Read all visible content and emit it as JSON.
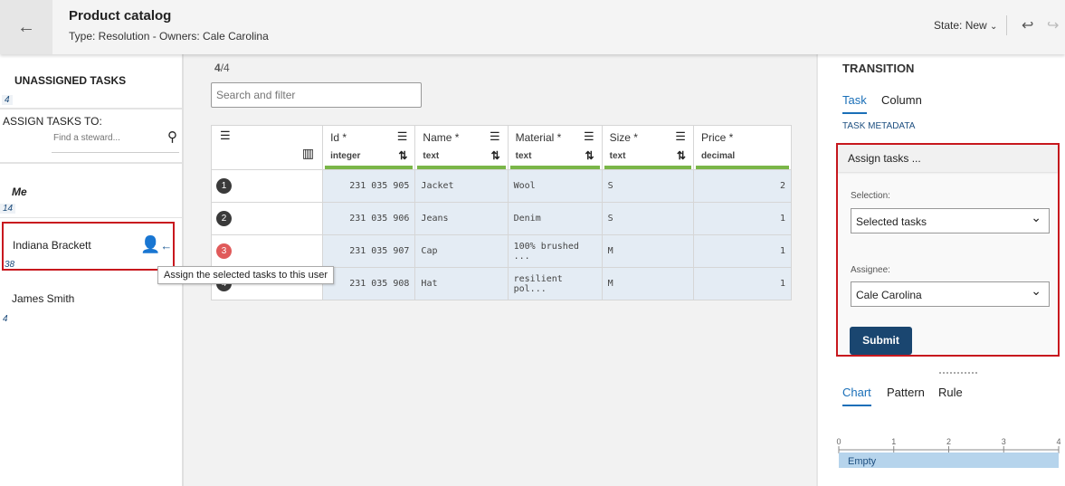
{
  "header": {
    "title": "Product catalog",
    "subtitle": "Type: Resolution - Owners: Cale Carolina",
    "state": "State: New",
    "icons": [
      "back-arrow-icon",
      "undo-icon",
      "redo-icon"
    ]
  },
  "left": {
    "unassigned_title": "UNASSIGNED TASKS",
    "unassigned_count": "4",
    "assign_label": "ASSIGN TASKS TO:",
    "search_placeholder": "Find a steward...",
    "stewards": [
      {
        "name": "Me",
        "count": "14"
      },
      {
        "name": "Indiana Brackett",
        "count": "38"
      },
      {
        "name": "James Smith",
        "count": "4"
      }
    ],
    "tooltip": "Assign the selected tasks to this user"
  },
  "main": {
    "count_bold": "4",
    "count_rest": "/4",
    "search_placeholder": "Search and filter",
    "columns": [
      {
        "name": "Id *",
        "type": "integer"
      },
      {
        "name": "Name *",
        "type": "text"
      },
      {
        "name": "Material *",
        "type": "text"
      },
      {
        "name": "Size *",
        "type": "text"
      },
      {
        "name": "Price *",
        "type": "decimal"
      }
    ],
    "rows": [
      {
        "n": "1",
        "id": "231 035 905",
        "name": "Jacket",
        "material": "Wool",
        "size": "S",
        "price": "2",
        "color": "#3a3a3a"
      },
      {
        "n": "2",
        "id": "231 035 906",
        "name": "Jeans",
        "material": "Denim",
        "size": "S",
        "price": "1",
        "color": "#3a3a3a"
      },
      {
        "n": "3",
        "id": "231 035 907",
        "name": "Cap",
        "material": "100% brushed ...",
        "size": "M",
        "price": "1",
        "color": "#e05a5a"
      },
      {
        "n": "4",
        "id": "231 035 908",
        "name": "Hat",
        "material": "resilient pol...",
        "size": "M",
        "price": "1",
        "color": "#3a3a3a"
      }
    ]
  },
  "right": {
    "title": "TRANSITION",
    "tabs": [
      "Task",
      "Column"
    ],
    "metadata": "TASK METADATA",
    "assign_header": "Assign tasks ...",
    "selection_label": "Selection:",
    "selection_value": "Selected tasks",
    "assignee_label": "Assignee:",
    "assignee_value": "Cale Carolina",
    "submit": "Submit",
    "bottom_tabs": [
      "Chart",
      "Pattern",
      "Rule"
    ]
  },
  "chart_data": {
    "type": "bar",
    "orientation": "horizontal",
    "categories": [
      "Empty"
    ],
    "values": [
      4
    ],
    "xlim": [
      0,
      4
    ],
    "ticks": [
      "0",
      "1",
      "2",
      "3",
      "4"
    ],
    "color": "#b6d4ec"
  }
}
